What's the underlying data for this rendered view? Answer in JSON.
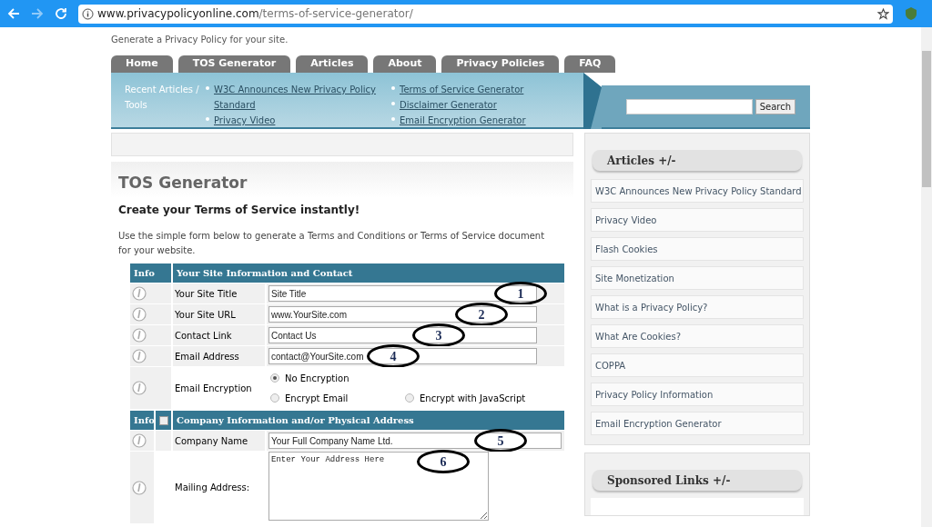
{
  "browser": {
    "url_host": "www.privacypolicyonline.com",
    "url_path": "/terms-of-service-generator/"
  },
  "site": {
    "tagline": "Generate a Privacy Policy for your site."
  },
  "nav_tabs": [
    "Home",
    "TOS Generator",
    "Articles",
    "About",
    "Privacy Policies",
    "FAQ"
  ],
  "recent": {
    "label": "Recent Articles / Tools",
    "columns": [
      [
        "W3C Announces New Privacy Policy Standard",
        "Privacy Video"
      ],
      [
        "Terms of Service Generator",
        "Disclaimer Generator",
        "Email Encryption Generator"
      ]
    ]
  },
  "search": {
    "button": "Search"
  },
  "page": {
    "title": "TOS Generator",
    "subtitle": "Create your Terms of Service instantly!",
    "intro": "Use the simple form below to generate a Terms and Conditions or Terms of Service document for your website."
  },
  "sections": [
    {
      "info": "Info",
      "heading": "Your Site Information and Contact",
      "rows": [
        {
          "kind": "text",
          "label": "Your Site Title",
          "value": "Site Title",
          "annotation": "1"
        },
        {
          "kind": "text",
          "label": "Your Site URL",
          "value": "www.YourSite.com",
          "annotation": "2"
        },
        {
          "kind": "text",
          "label": "Contact Link",
          "value": "Contact Us",
          "annotation": "3"
        },
        {
          "kind": "text",
          "label": "Email Address",
          "value": "contact@YourSite.com",
          "annotation": "4"
        },
        {
          "kind": "radio",
          "label": "Email Encryption",
          "options": [
            {
              "label": "No Encryption",
              "selected": true
            },
            {
              "label": "Encrypt Email",
              "selected": false
            },
            {
              "label": "Encrypt with JavaScript",
              "selected": false
            }
          ]
        }
      ]
    },
    {
      "info": "Info",
      "checkbox": {
        "checked": false
      },
      "heading": "Company Information and/or Physical Address",
      "rows": [
        {
          "kind": "text",
          "label": "Company Name",
          "value": "Your Full Company Name Ltd.",
          "annotation": "5"
        },
        {
          "kind": "textarea",
          "label": "Mailing Address:",
          "value": "Enter Your Address Here",
          "annotation": "6"
        }
      ]
    }
  ],
  "sidebar": {
    "articles": {
      "title": "Articles +/-",
      "items": [
        "W3C Announces New Privacy Policy Standard",
        "Privacy Video",
        "Flash Cookies",
        "Site Monetization",
        "What is a Privacy Policy?",
        "What Are Cookies?",
        "COPPA",
        "Privacy Policy Information",
        "Email Encryption Generator"
      ]
    },
    "sponsored": {
      "title": "Sponsored Links +/-"
    }
  }
}
